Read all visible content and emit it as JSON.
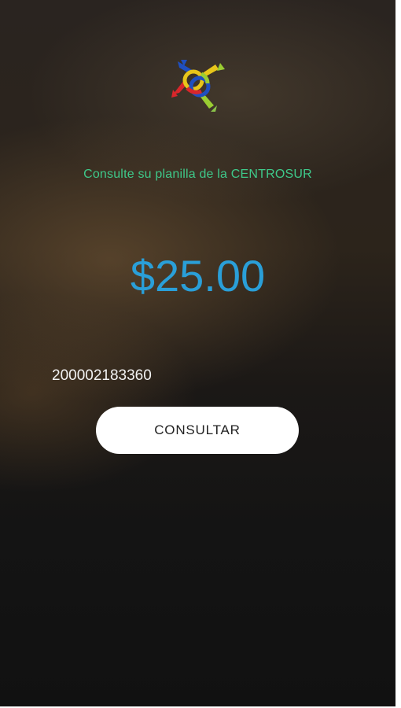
{
  "app": {
    "logo_icon": "centrosur-arrows-logo-icon",
    "subtitle": "Consulte su planilla de la CENTROSUR",
    "amount": "$25.00",
    "account_number": "200002183360",
    "consult_button_label": "CONSULTAR"
  },
  "colors": {
    "subtitle": "#3ec98a",
    "amount": "#2a9fd8",
    "button_bg": "#ffffff",
    "button_text": "#222222"
  }
}
